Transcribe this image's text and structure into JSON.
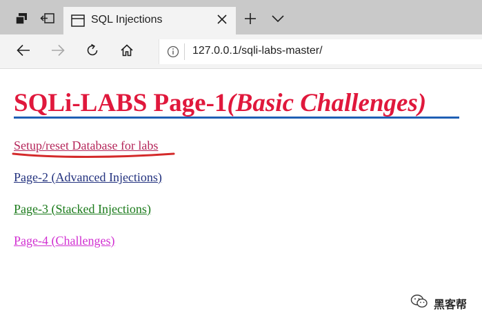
{
  "browser": {
    "tab": {
      "title": "SQL Injections"
    },
    "address": {
      "url": "127.0.0.1/sqli-labs-master/"
    },
    "icons": {
      "tab_sets": "tab-sets-icon",
      "set_aside": "set-aside-tabs-icon",
      "page": "page-icon",
      "close": "close-icon",
      "new_tab": "plus-icon",
      "tab_list": "chevron-down-icon",
      "back": "back-arrow-icon",
      "forward": "forward-arrow-icon",
      "refresh": "refresh-icon",
      "home": "home-icon",
      "info": "info-icon"
    }
  },
  "page": {
    "heading_main": "SQLi-LABS Page-1",
    "heading_italic": "(Basic Challenges)",
    "links": [
      {
        "label": "Setup/reset Database for labs",
        "color": "#b5265a"
      },
      {
        "label": "Page-2 (Advanced Injections)",
        "color": "#22317e"
      },
      {
        "label": "Page-3 (Stacked Injections)",
        "color": "#1a7a1a"
      },
      {
        "label": "Page-4 (Challenges)",
        "color": "#d12fd1"
      }
    ],
    "accent_colors": {
      "heading": "#e0183c",
      "heading_underline": "#1e5fb4",
      "annotation": "#d42a2a"
    }
  },
  "watermark": {
    "text": "黑客帮",
    "icon": "wechat-icon"
  }
}
